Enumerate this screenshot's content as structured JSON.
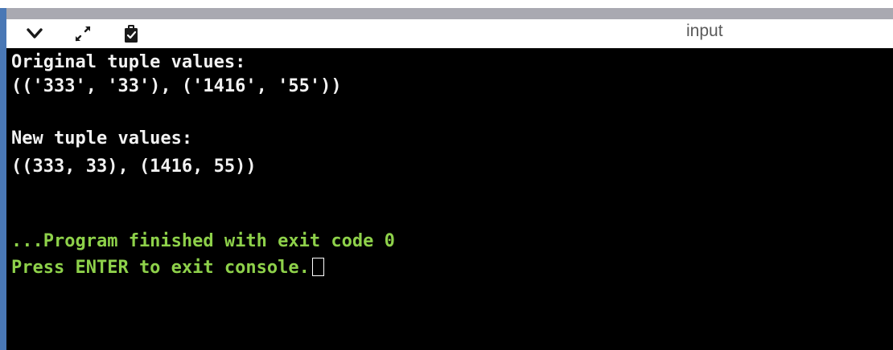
{
  "toolbar": {
    "title": "input",
    "icons": [
      "chevron-down-icon",
      "expand-icon",
      "clipboard-copy-icon"
    ]
  },
  "console": {
    "lines": [
      {
        "text": "Original tuple values:",
        "color": "#f2f2f2"
      },
      {
        "text": "(('333', '33'), ('1416', '55'))",
        "color": "#f2f2f2"
      },
      {
        "text": "",
        "color": "#f2f2f2"
      },
      {
        "text": "New tuple values:",
        "color": "#f2f2f2"
      },
      {
        "text": "((333, 33), (1416, 55))",
        "color": "#f2f2f2"
      },
      {
        "text": "",
        "color": "#f2f2f2"
      },
      {
        "text": "",
        "color": "#f2f2f2"
      },
      {
        "text": "...Program finished with exit code 0",
        "color": "#8ed14a"
      },
      {
        "text": "Press ENTER to exit console.",
        "color": "#8ed14a"
      }
    ]
  },
  "colors": {
    "accent": "#4a78b5",
    "console_bg": "#000000",
    "output_text": "#f2f2f2",
    "status_text": "#8ed14a"
  }
}
